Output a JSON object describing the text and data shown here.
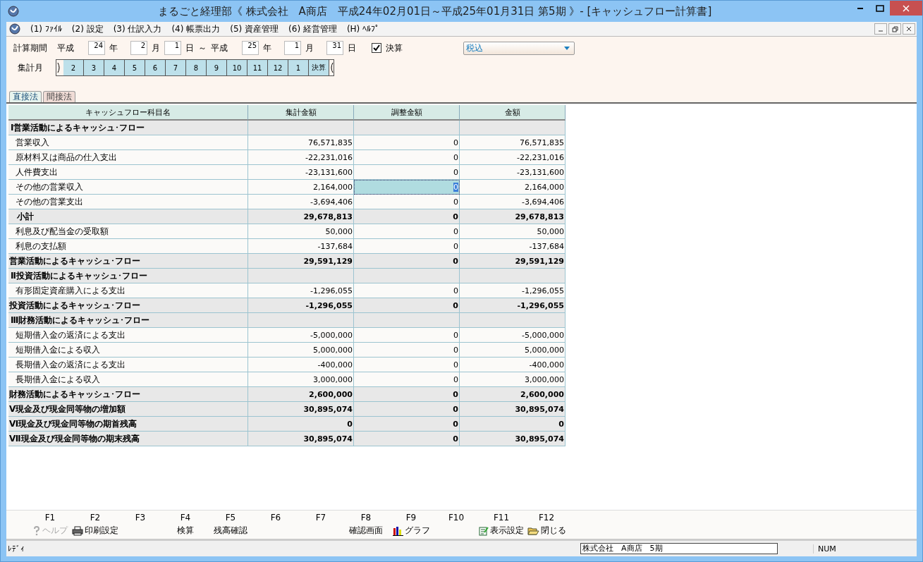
{
  "window": {
    "title": "まるごと経理部《 株式会社　A商店　平成24年02月01日～平成25年01月31日 第5期 》- [キャッシュフロー計算書]"
  },
  "menu": [
    "(1) ﾌｧｲﾙ",
    "(2) 設定",
    "(3) 仕訳入力",
    "(4) 帳票出力",
    "(5) 資産管理",
    "(6) 経営管理",
    "(H) ﾍﾙﾌﾟ"
  ],
  "period": {
    "label": "計算期間",
    "era_from": "平成",
    "year_from": "24",
    "year_unit_from": "年",
    "month_from": "2",
    "month_unit_from": "月",
    "day_from": "1",
    "day_unit_from": "日",
    "separator": "～",
    "era_to": "平成",
    "year_to": "25",
    "year_unit_to": "年",
    "month_to": "1",
    "month_unit_to": "月",
    "day_to": "31",
    "day_unit_to": "日",
    "closing": {
      "label": "決算",
      "checked": true
    },
    "tax_mode": "税込"
  },
  "months": {
    "label": "集計月",
    "items": [
      "2",
      "3",
      "4",
      "5",
      "6",
      "7",
      "8",
      "9",
      "10",
      "11",
      "12",
      "1",
      "決算"
    ]
  },
  "tabs": [
    {
      "label": "直接法",
      "selected": true
    },
    {
      "label": "間接法",
      "selected": false
    }
  ],
  "table": {
    "columns": [
      "キャッシュフロー科目名",
      "集計金額",
      "調整金額",
      "金額"
    ],
    "rows": [
      {
        "kind": "heading",
        "name": "Ⅰ営業活動によるキャッシュ･フロー"
      },
      {
        "kind": "item",
        "name": "営業収入",
        "total": "76,571,835",
        "adjust": "0",
        "amount": "76,571,835",
        "selected": false
      },
      {
        "kind": "item",
        "name": "原材料又は商品の仕入支出",
        "total": "-22,231,016",
        "adjust": "0",
        "amount": "-22,231,016",
        "selected": false
      },
      {
        "kind": "item",
        "name": "人件費支出",
        "total": "-23,131,600",
        "adjust": "0",
        "amount": "-23,131,600",
        "selected": false
      },
      {
        "kind": "item",
        "name": "その他の営業収入",
        "total": "2,164,000",
        "adjust": "0",
        "amount": "2,164,000",
        "selected": true
      },
      {
        "kind": "item",
        "name": "その他の営業支出",
        "total": "-3,694,406",
        "adjust": "0",
        "amount": "-3,694,406",
        "selected": false
      },
      {
        "kind": "subtotal",
        "name": "小計",
        "total": "29,678,813",
        "adjust": "0",
        "amount": "29,678,813",
        "selected": false
      },
      {
        "kind": "item",
        "name": "利息及び配当金の受取額",
        "total": "50,000",
        "adjust": "0",
        "amount": "50,000",
        "selected": false
      },
      {
        "kind": "item",
        "name": "利息の支払額",
        "total": "-137,684",
        "adjust": "0",
        "amount": "-137,684",
        "selected": false
      },
      {
        "kind": "total",
        "name": "営業活動によるキャッシュ･フロー",
        "total": "29,591,129",
        "adjust": "0",
        "amount": "29,591,129",
        "selected": false
      },
      {
        "kind": "heading",
        "name": "Ⅱ投資活動によるキャッシュ･フロー"
      },
      {
        "kind": "item",
        "name": "有形固定資産購入による支出",
        "total": "-1,296,055",
        "adjust": "0",
        "amount": "-1,296,055",
        "selected": false
      },
      {
        "kind": "total",
        "name": "投資活動によるキャッシュ･フロー",
        "total": "-1,296,055",
        "adjust": "0",
        "amount": "-1,296,055",
        "selected": false
      },
      {
        "kind": "heading",
        "name": "Ⅲ財務活動によるキャッシュ･フロー"
      },
      {
        "kind": "item",
        "name": "短期借入金の返済による支出",
        "total": "-5,000,000",
        "adjust": "0",
        "amount": "-5,000,000",
        "selected": false
      },
      {
        "kind": "item",
        "name": "短期借入金による収入",
        "total": "5,000,000",
        "adjust": "0",
        "amount": "5,000,000",
        "selected": false
      },
      {
        "kind": "item",
        "name": "長期借入金の返済による支出",
        "total": "-400,000",
        "adjust": "0",
        "amount": "-400,000",
        "selected": false
      },
      {
        "kind": "item",
        "name": "長期借入金による収入",
        "total": "3,000,000",
        "adjust": "0",
        "amount": "3,000,000",
        "selected": false
      },
      {
        "kind": "total",
        "name": "財務活動によるキャッシュ･フロー",
        "total": "2,600,000",
        "adjust": "0",
        "amount": "2,600,000",
        "selected": false
      },
      {
        "kind": "total",
        "name": "Ⅴ現金及び現金同等物の増加額",
        "total": "30,895,074",
        "adjust": "0",
        "amount": "30,895,074",
        "selected": false
      },
      {
        "kind": "total",
        "name": "Ⅵ現金及び現金同等物の期首残高",
        "total": "0",
        "adjust": "0",
        "amount": "0",
        "selected": false
      },
      {
        "kind": "total",
        "name": "Ⅶ現金及び現金同等物の期末残高",
        "total": "30,895,074",
        "adjust": "0",
        "amount": "30,895,074",
        "selected": false
      }
    ]
  },
  "function_keys": [
    {
      "key": "F1",
      "label": "ヘルプ",
      "kind": "help",
      "disabled": true
    },
    {
      "key": "F2",
      "label": "印刷設定",
      "kind": "print",
      "disabled": false
    },
    {
      "key": "F3"
    },
    {
      "key": "F4",
      "label": "検算",
      "disabled": false
    },
    {
      "key": "F5",
      "label": "残高確認",
      "disabled": false
    },
    {
      "key": "F6"
    },
    {
      "key": "F7"
    },
    {
      "key": "F8",
      "label": "確認画面",
      "disabled": false
    },
    {
      "key": "F9",
      "label": "グラフ",
      "kind": "chart",
      "disabled": false
    },
    {
      "key": "F10"
    },
    {
      "key": "F11",
      "label": "表示設定",
      "kind": "edit",
      "disabled": false
    },
    {
      "key": "F12",
      "label": "閉じる",
      "kind": "folder",
      "disabled": false
    }
  ],
  "status_bar": {
    "message": "ﾚﾃﾞｨ",
    "company": "株式会社　A商店　5期",
    "num": "NUM"
  }
}
